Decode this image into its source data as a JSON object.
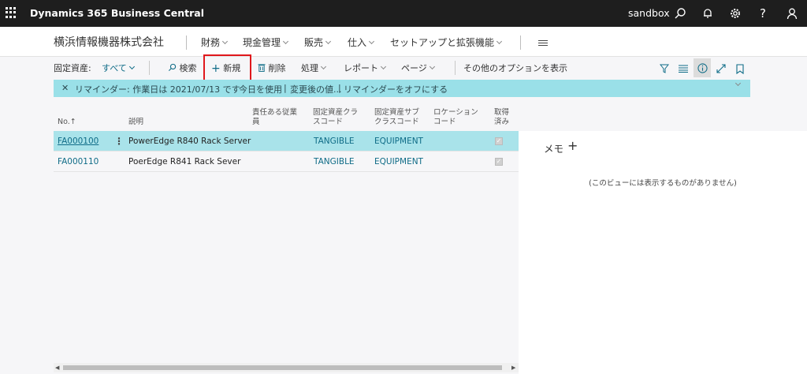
{
  "topbar": {
    "app_title": "Dynamics 365 Business Central",
    "environment": "sandbox",
    "icons": [
      "waffle-icon",
      "search-icon",
      "bell-icon",
      "gear-icon",
      "help-icon",
      "user-icon"
    ]
  },
  "navbar": {
    "company": "横浜情報機器株式会社",
    "items": [
      {
        "label": "財務"
      },
      {
        "label": "現金管理"
      },
      {
        "label": "販売"
      },
      {
        "label": "仕入"
      },
      {
        "label": "セットアップと拡張機能"
      }
    ]
  },
  "actionbar": {
    "view_label": "固定資産:",
    "view_filter": "すべて",
    "search": "検索",
    "new": "新規",
    "delete": "削除",
    "process": "処理",
    "report": "レポート",
    "page": "ページ",
    "more_options": "その他のオプションを表示"
  },
  "reminder": {
    "close": "✕",
    "text": "リマインダー: 作業日は 2021/07/13 です",
    "link_use_today": "今日を使用",
    "sep1": "|",
    "link_change": "変更後の値...",
    "sep2": "|",
    "link_turn_off": "リマインダーをオフにする"
  },
  "table": {
    "headers": {
      "no": "No.↑",
      "description": "説明",
      "responsible_line1": "責任ある従業",
      "responsible_line2": "員",
      "class_line1": "固定資産クラ",
      "class_line2": "スコード",
      "subclass_line1": "固定資産サブ",
      "subclass_line2": "クラスコード",
      "location_line1": "ロケーション",
      "location_line2": "コード",
      "acquired_line1": "取得",
      "acquired_line2": "済み"
    },
    "rows": [
      {
        "no": "FA000100",
        "description": "PowerEdge R840 Rack Server",
        "class": "TANGIBLE",
        "subclass": "EQUIPMENT",
        "acquired": true
      },
      {
        "no": "FA000110",
        "description": "PoerEdge R841 Rack Sever",
        "class": "TANGIBLE",
        "subclass": "EQUIPMENT",
        "acquired": true
      }
    ]
  },
  "memo": {
    "title": "メモ",
    "add": "+",
    "empty": "(このビューには表示するものがありません)"
  },
  "colors": {
    "topbar_bg": "#1e1e1e",
    "accent": "#0f6c87",
    "selected_row": "#a9e3ea",
    "reminder_bg": "#9ae0e8",
    "highlight_box": "#e0181c"
  }
}
